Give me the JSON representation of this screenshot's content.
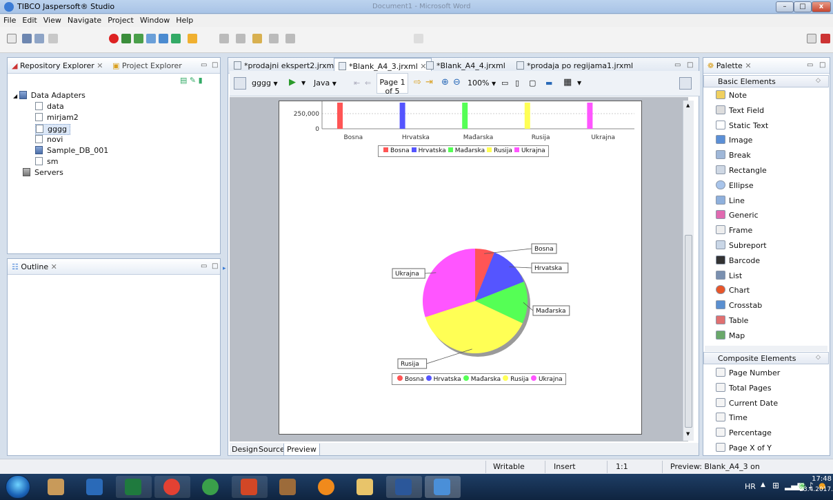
{
  "window": {
    "title": "TIBCO Jaspersoft® Studio",
    "background_title": "Document1 - Microsoft Word",
    "controls": {
      "minimize": "–",
      "maximize": "□",
      "close": "x"
    }
  },
  "menu": [
    "File",
    "Edit",
    "View",
    "Navigate",
    "Project",
    "Window",
    "Help"
  ],
  "left_panel": {
    "tabs": [
      {
        "label": "Repository Explorer"
      },
      {
        "label": "Project Explorer"
      }
    ],
    "tree": [
      {
        "label": "Data Adapters",
        "level": 0,
        "icon": "db"
      },
      {
        "label": "data",
        "level": 1,
        "icon": "doc"
      },
      {
        "label": "mirjam2",
        "level": 1,
        "icon": "doc"
      },
      {
        "label": "gggg",
        "level": 1,
        "icon": "doc",
        "selected": true
      },
      {
        "label": "novi",
        "level": 1,
        "icon": "doc"
      },
      {
        "label": "Sample_DB_001",
        "level": 1,
        "icon": "db"
      },
      {
        "label": "sm",
        "level": 1,
        "icon": "doc"
      },
      {
        "label": "Servers",
        "level": 0,
        "icon": "srv"
      }
    ],
    "outline_tab": "Outline"
  },
  "editor": {
    "tabs": [
      {
        "label": "*prodajni ekspert2.jrxml",
        "active": false
      },
      {
        "label": "*Blank_A4_3.jrxml",
        "active": true
      },
      {
        "label": "*Blank_A4_4.jrxml",
        "active": false
      },
      {
        "label": "*prodaja po regijama1.jrxml",
        "active": false
      }
    ],
    "preview_toolbar": {
      "adapter": "gggg",
      "language": "Java",
      "page_indicator": "Page 1 of 5",
      "zoom": "100%"
    },
    "bottom_tabs": [
      "Design",
      "Source",
      "Preview"
    ],
    "active_bottom_tab": "Preview"
  },
  "chart_data": [
    {
      "type": "bar",
      "categories": [
        "Bosna",
        "Hrvatska",
        "Mađarska",
        "Rusija",
        "Ukrajna"
      ],
      "y_ticks": [
        "250,000",
        "0"
      ],
      "legend": [
        "Bosna",
        "Hrvatska",
        "Mađarska",
        "Rusija",
        "Ukrajna"
      ],
      "legend_placement": "bottom",
      "colors": [
        "#ff5555",
        "#5555ff",
        "#55ff55",
        "#ffff55",
        "#ff55ff"
      ],
      "bar_color_names": [
        "red",
        "blue",
        "green",
        "yellow",
        "magenta"
      ]
    },
    {
      "type": "pie",
      "labels": [
        "Bosna",
        "Hrvatska",
        "Mađarska",
        "Rusija",
        "Ukrajna"
      ],
      "values": [
        6,
        13,
        13,
        38,
        30
      ],
      "colors": [
        "#ff5555",
        "#5555ff",
        "#55ff55",
        "#ffff55",
        "#ff55ff"
      ],
      "legend": [
        "Bosna",
        "Hrvatska",
        "Mađarska",
        "Rusija",
        "Ukrajna"
      ],
      "legend_placement": "bottom"
    }
  ],
  "palette": {
    "tab": "Palette",
    "basic_section": "Basic Elements",
    "basic_items": [
      {
        "label": "Note",
        "icon": "note-icon",
        "color": "#f0d060"
      },
      {
        "label": "Text Field",
        "icon": "text-field-icon",
        "color": "#dddddd"
      },
      {
        "label": "Static Text",
        "icon": "static-text-icon",
        "color": "#ffffff"
      },
      {
        "label": "Image",
        "icon": "image-icon",
        "color": "#5b8fd6"
      },
      {
        "label": "Break",
        "icon": "break-icon",
        "color": "#9fb7d8"
      },
      {
        "label": "Rectangle",
        "icon": "rectangle-icon",
        "color": "#cfd8e4"
      },
      {
        "label": "Ellipse",
        "icon": "ellipse-icon",
        "color": "#a8c4ea"
      },
      {
        "label": "Line",
        "icon": "line-icon",
        "color": "#8fb0dc"
      },
      {
        "label": "Generic",
        "icon": "generic-icon",
        "color": "#e06ab0"
      },
      {
        "label": "Frame",
        "icon": "frame-icon",
        "color": "#eeeeee"
      },
      {
        "label": "Subreport",
        "icon": "subreport-icon",
        "color": "#c9d6e6"
      },
      {
        "label": "Barcode",
        "icon": "barcode-icon",
        "color": "#333333"
      },
      {
        "label": "List",
        "icon": "list-icon",
        "color": "#7a90b0"
      },
      {
        "label": "Chart",
        "icon": "chart-icon",
        "color": "#e8562a"
      },
      {
        "label": "Crosstab",
        "icon": "crosstab-icon",
        "color": "#5a8fd0"
      },
      {
        "label": "Table",
        "icon": "table-icon",
        "color": "#e07070"
      },
      {
        "label": "Map",
        "icon": "map-icon",
        "color": "#6aa86a"
      }
    ],
    "composite_section": "Composite Elements",
    "composite_items": [
      {
        "label": "Page Number",
        "icon": "page-number-icon"
      },
      {
        "label": "Total Pages",
        "icon": "total-pages-icon"
      },
      {
        "label": "Current Date",
        "icon": "current-date-icon"
      },
      {
        "label": "Time",
        "icon": "time-icon"
      },
      {
        "label": "Percentage",
        "icon": "percentage-icon"
      },
      {
        "label": "Page X of Y",
        "icon": "page-x-of-y-icon"
      }
    ]
  },
  "status": {
    "writable": "Writable",
    "insert": "Insert",
    "position": "1:1",
    "message": "Preview: Blank_A4_3 on"
  },
  "taskbar": {
    "lang": "HR",
    "time": "17:48",
    "date": "23.4.2017."
  }
}
